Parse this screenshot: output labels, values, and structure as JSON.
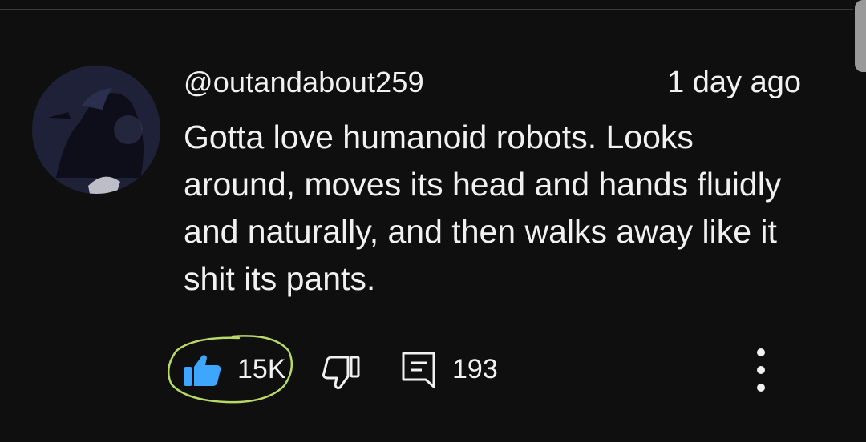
{
  "comment": {
    "username": "@outandabout259",
    "timestamp": "1 day ago",
    "text": "Gotta love humanoid robots. Looks around, moves its head and hands fluidly and naturally, and then walks away like it shit its pants."
  },
  "actions": {
    "like_count": "15K",
    "reply_count": "193"
  },
  "colors": {
    "background": "#0f0f0f",
    "text": "#f1f1f1",
    "like_icon_active": "#3ea6ff",
    "annotation": "#b8d968"
  },
  "icons": {
    "like": "thumbs-up-icon",
    "dislike": "thumbs-down-icon",
    "reply": "comment-icon",
    "more": "more-vertical-icon"
  }
}
